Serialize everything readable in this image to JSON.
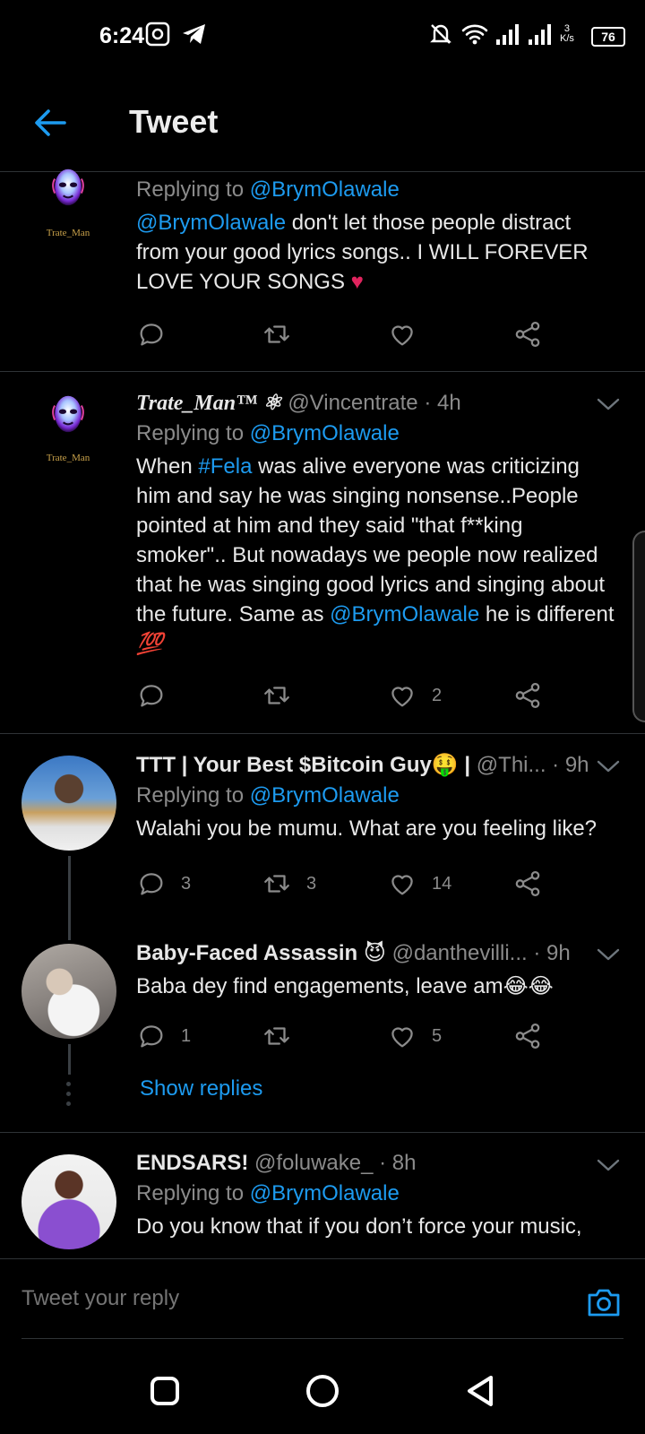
{
  "status_bar": {
    "time": "6:24",
    "net_speed_value": "3",
    "net_speed_unit": "K/s",
    "battery": "76"
  },
  "header": {
    "title": "Tweet"
  },
  "tweets": [
    {
      "logo_caption": "Trate_Man",
      "replying_prefix": "Replying to ",
      "replying_to": "@BrymOlawale",
      "mention": "@BrymOlawale",
      "text": " don't let those people distract from your good lyrics songs..  I WILL FOREVER LOVE YOUR SONGS ",
      "emoji": "♥"
    },
    {
      "display_name": "Trate_Man™ ⚛",
      "handle": "@Vincentrate",
      "time": " · 4h",
      "logo_caption": "Trate_Man",
      "replying_prefix": "Replying to ",
      "replying_to": "@BrymOlawale",
      "text_1": "When ",
      "hashtag": "#Fela",
      "text_2": " was alive everyone was criticizing him and say he was singing nonsense..People pointed at him and they said \"that f**king smoker\".. But nowadays we people now realized that he was singing good lyrics and singing about the future. Same as ",
      "mention": "@BrymOlawale",
      "text_3": " he is different ",
      "emoji": "💯",
      "likes": "2"
    },
    {
      "display_name": "TTT | Your Best $Bitcoin Guy🤑 |",
      "handle": " @Thi...",
      "time": " · 9h",
      "replying_prefix": "Replying to ",
      "replying_to": "@BrymOlawale",
      "text": "Walahi you be mumu. What are you feeling like?",
      "replies": "3",
      "retweets": "3",
      "likes": "14"
    },
    {
      "display_name": "Baby-Faced Assassin 😈",
      "handle": " @danthevilli...",
      "time": " · 9h",
      "text": "Baba dey find engagements, leave am😂😂",
      "replies": "1",
      "likes": "5",
      "show_replies": "Show replies"
    },
    {
      "display_name": "ENDSARS!",
      "handle": " @foluwake_",
      "time": " · 8h",
      "replying_prefix": "Replying to ",
      "replying_to": "@BrymOlawale",
      "text": "Do you know that if you don’t force your music,"
    }
  ],
  "composer": {
    "placeholder": "Tweet your reply"
  },
  "icons": {
    "back": "arrow-left-icon",
    "reply": "speech-bubble-icon",
    "retweet": "retweet-icon",
    "like": "heart-icon",
    "share": "share-icon",
    "camera": "camera-icon",
    "more": "chevron-down-icon"
  },
  "colors": {
    "accent": "#1d9bf0",
    "background": "#000000",
    "divider": "#2f3336",
    "muted": "#8b8b8b"
  }
}
